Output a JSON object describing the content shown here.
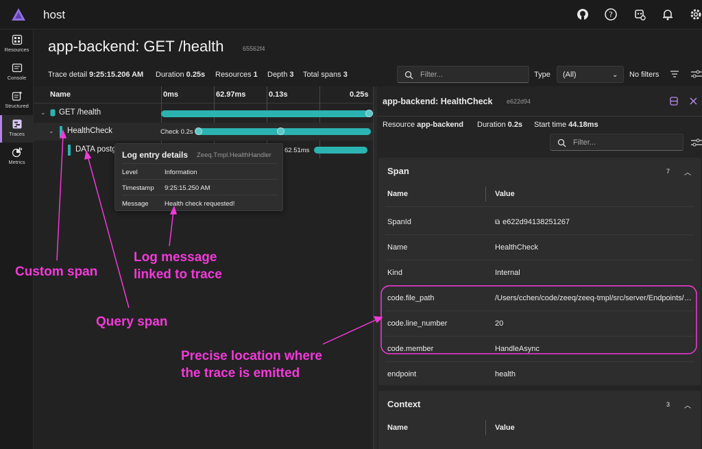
{
  "app": {
    "title": "host"
  },
  "nav": [
    {
      "label": "Resources",
      "icon": "resources-icon"
    },
    {
      "label": "Console",
      "icon": "console-icon"
    },
    {
      "label": "Structured",
      "icon": "structured-icon"
    },
    {
      "label": "Traces",
      "icon": "traces-icon",
      "active": true
    },
    {
      "label": "Metrics",
      "icon": "metrics-icon"
    }
  ],
  "page": {
    "title": "app-backend: GET /health",
    "trace_id": "65562f4",
    "meta": {
      "trace_detail_label": "Trace detail",
      "trace_detail_value": "9:25:15.206 AM",
      "duration_label": "Duration",
      "duration_value": "0.25s",
      "resources_label": "Resources",
      "resources_value": "1",
      "depth_label": "Depth",
      "depth_value": "3",
      "total_spans_label": "Total spans",
      "total_spans_value": "3"
    },
    "filter_placeholder": "Filter...",
    "type_label": "Type",
    "type_value": "(All)",
    "no_filters": "No filters"
  },
  "waterfall": {
    "name_header": "Name",
    "ticks": [
      "0ms",
      "62.97ms",
      "0.13s",
      "0.25s"
    ],
    "rows": [
      {
        "label": "GET /health"
      },
      {
        "label": "HealthCheck",
        "bar_label": "Check 0.2s"
      },
      {
        "label": "DATA postg",
        "bar_label": "62.51ms"
      }
    ]
  },
  "tooltip": {
    "title": "Log entry details",
    "source": "Zeeq.Tmpl.HealthHandler",
    "rows": [
      {
        "k": "Level",
        "v": "Information"
      },
      {
        "k": "Timestamp",
        "v": "9:25:15.250 AM"
      },
      {
        "k": "Message",
        "v": "Health check requested!"
      }
    ]
  },
  "annotations": {
    "custom_span": "Custom span",
    "log_message_1": "Log message",
    "log_message_2": "linked to trace",
    "query_span": "Query span",
    "location_1": "Precise location where",
    "location_2": "the trace is emitted"
  },
  "detail": {
    "title": "app-backend: HealthCheck",
    "id": "e622d94",
    "resource_label": "Resource",
    "resource_value": "app-backend",
    "duration_label": "Duration",
    "duration_value": "0.2s",
    "start_label": "Start time",
    "start_value": "44.18ms",
    "filter_placeholder": "Filter...",
    "span_section": {
      "title": "Span",
      "count": "7",
      "col_name": "Name",
      "col_value": "Value",
      "rows": [
        {
          "k": "SpanId",
          "v": "e622d94138251267"
        },
        {
          "k": "Name",
          "v": "HealthCheck"
        },
        {
          "k": "Kind",
          "v": "Internal"
        },
        {
          "k": "code.file_path",
          "v": "/Users/cchen/code/zeeq/zeeq-tmpl/src/server/Endpoints/HealthHandler.cs"
        },
        {
          "k": "code.line_number",
          "v": "20"
        },
        {
          "k": "code.member",
          "v": "HandleAsync"
        },
        {
          "k": "endpoint",
          "v": "health"
        }
      ]
    },
    "context_section": {
      "title": "Context",
      "count": "3",
      "col_name": "Name",
      "col_value": "Value"
    }
  },
  "colors": {
    "accent": "#b583e8",
    "bar": "#2bb3b1",
    "annotation": "#f23ad9"
  }
}
